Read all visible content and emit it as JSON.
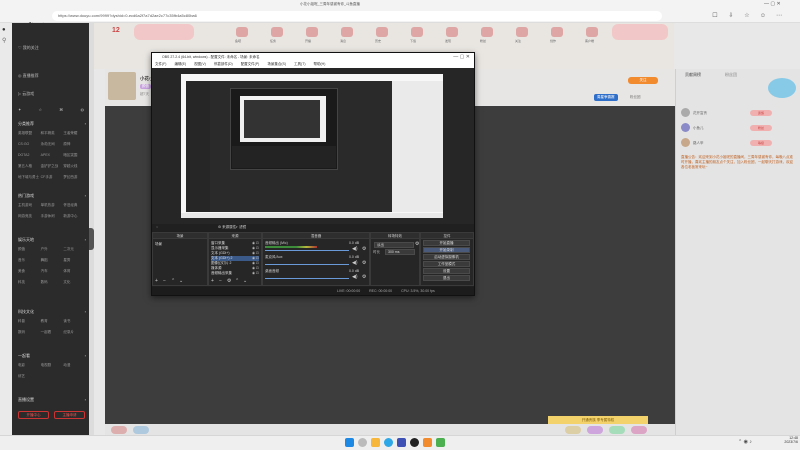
{
  "browser": {
    "window_title": "小花小姐呢_三周年感谢有你_斗鱼直播",
    "url": "https://www.douyu.com/9999?dyshid=0-ecd6a2f7a7d2ae2c77c35fb4a5c80ba6"
  },
  "site_nav": {
    "items": [
      "我的关注",
      "直播推荐",
      "云游戏"
    ],
    "section1_title": "分类推荐",
    "section1_grid": [
      "英雄联盟",
      "和平精英",
      "王者荣耀",
      "CS:GO",
      "永劫无间",
      "原神",
      "DOTA2",
      "APEX",
      "暗区突围",
      "第五人格",
      "金铲铲之战",
      "穿越火线",
      "地下城与勇士",
      "CF手游",
      "梦幻西游"
    ],
    "section2_title": "热门游戏",
    "section2_grid": [
      "主机游戏",
      "单机热游",
      "怀旧经典",
      "网游竞技",
      "手游休闲",
      "新游中心"
    ],
    "section3_title": "娱乐天地",
    "section3_grid": [
      "颜值",
      "户外",
      "二次元",
      "音乐",
      "舞蹈",
      "星秀",
      "美食",
      "汽车",
      "体育",
      "科技",
      "数码",
      "文化"
    ],
    "section4_title": "科技文化",
    "section4_grid": [
      "科普",
      "教育",
      "读书",
      "数码",
      "一起看",
      "纪录片"
    ],
    "section5_title": "一起看",
    "section5_grid": [
      "电影",
      "电视剧",
      "动漫",
      "综艺"
    ],
    "section6_title": "直播设置",
    "btn_left": "开播中心",
    "btn_right": "主播申请"
  },
  "toolbar": {
    "level": "12",
    "items": [
      "鱼吧",
      "任务",
      "开播",
      "消息",
      "历史",
      "下载",
      "发现",
      "粉丝",
      "关注",
      "创作",
      "客户端"
    ]
  },
  "streamer": {
    "name": "小花小姐呢",
    "tag": "颜值",
    "follow_button": "关注",
    "stats": "超7天",
    "fans_label": "粉丝团",
    "promo_badge": "周星争霸赛"
  },
  "obs": {
    "title": "OBS 27.2.4 (64-bit, windows) - 配置文件: 未命名 - 场景: 未命名",
    "menu": [
      "文件(F)",
      "编辑(E)",
      "视图(V)",
      "停靠部件(D)",
      "配置文件(P)",
      "场景集合(S)",
      "工具(T)",
      "帮助(H)"
    ],
    "docks": {
      "scenes": "场景",
      "scenes_list": [
        "场景"
      ],
      "sources": "来源",
      "sources_list": [
        "窗口采集",
        "显示器采集",
        "文本 (GDI+)",
        "文本 (GDI+) 2",
        "图像幻灯片 2",
        "媒体源",
        "音频输出采集"
      ],
      "mixer": "混音器",
      "mixer_channels": [
        {
          "name": "音频输出 (Mic)",
          "db": "0.0 dB",
          "level": 0.62
        },
        {
          "name": "麦克风/Aux",
          "db": "0.0 dB",
          "level": 0.0
        },
        {
          "name": "桌面音频",
          "db": "0.0 dB",
          "level": 0.0
        }
      ],
      "transitions": "转场特效",
      "transition_type": "淡出",
      "duration_label": "时长",
      "duration_value": "300 ms",
      "controls": "控件",
      "controls_buttons": [
        "开始直播",
        "开始录制",
        "启动虚拟摄像机",
        "工作室模式",
        "设置",
        "退出"
      ],
      "active_button_index": 1
    },
    "preview_header_left": "来源属性",
    "preview_header_mid": "滤镜",
    "status": [
      "LIVE: 00:00:00",
      "REC: 00:00:00",
      "CPU: 3.5%, 30.00 fps"
    ]
  },
  "chat": {
    "tabs": [
      "贡献周榜",
      "粉丝团"
    ],
    "users": [
      {
        "name": "花开富贵",
        "badge": "贵族"
      },
      {
        "name": "小鱼儿",
        "badge": "粉丝"
      },
      {
        "name": "路人甲",
        "badge": "等级"
      }
    ],
    "notice": "直播公告：欢迎来到小花小姐呢的直播间，三周年感谢有你，每晚八点准时开播，喜欢主播的朋友点个关注，加入粉丝团，一起聊天打游戏，欢迎各位老板常来玩~"
  },
  "gift_promo": "开通贵族  享专属特权",
  "taskbar": {
    "time": "12:48",
    "date": "2023/7/6"
  }
}
